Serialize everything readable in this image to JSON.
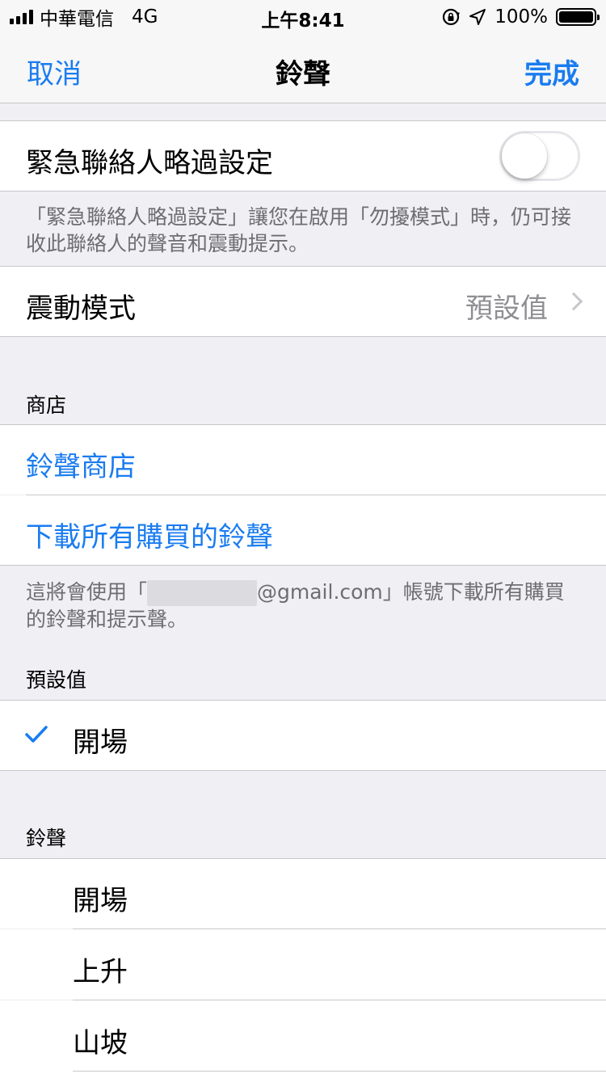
{
  "status_bar": {
    "carrier": "中華電信",
    "network": "4G",
    "time": "上午8:41",
    "battery": "100%"
  },
  "nav": {
    "cancel": "取消",
    "title": "鈴聲",
    "done": "完成"
  },
  "emergency_bypass": {
    "label": "緊急聯絡人略過設定",
    "enabled": false,
    "footnote": "「緊急聯絡人略過設定」讓您在啟用「勿擾模式」時，仍可接收此聯絡人的聲音和震動提示。"
  },
  "vibration": {
    "label": "震動模式",
    "value": "預設值"
  },
  "store_section": {
    "header": "商店",
    "items": [
      "鈴聲商店",
      "下載所有購買的鈴聲"
    ],
    "footnote_before": "這將會使用「",
    "footnote_after": "@gmail.com」帳號下載所有購買的鈴聲和提示聲。"
  },
  "default_section": {
    "header": "預設值",
    "selected": "開場"
  },
  "ringtones_section": {
    "header": "鈴聲",
    "items": [
      "開場",
      "上升",
      "山坡"
    ]
  },
  "colors": {
    "accent": "#1a7cf0",
    "background": "#efeff4"
  }
}
